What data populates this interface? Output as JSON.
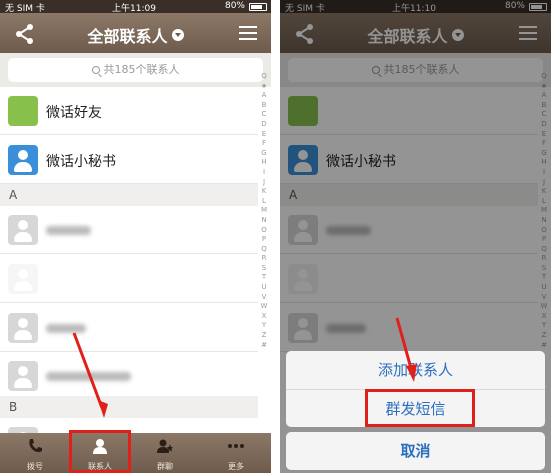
{
  "left": {
    "status": {
      "carrier": "无 SIM 卡",
      "time": "上午11:09",
      "battery": "80%"
    },
    "header": {
      "title": "全部联系人"
    },
    "search": {
      "placeholder": "共185个联系人"
    },
    "rows": [
      {
        "label": "微话好友",
        "avatar": "green"
      },
      {
        "label": "微话小秘书",
        "avatar": "blue"
      }
    ],
    "sections": [
      "A",
      "B"
    ],
    "index": [
      "Q",
      "★",
      "A",
      "B",
      "C",
      "D",
      "E",
      "F",
      "G",
      "H",
      "I",
      "J",
      "K",
      "L",
      "M",
      "N",
      "O",
      "P",
      "Q",
      "R",
      "S",
      "T",
      "U",
      "V",
      "W",
      "X",
      "Y",
      "Z",
      "#"
    ],
    "tabs": [
      {
        "label": "拨号",
        "icon": "phone-icon"
      },
      {
        "label": "联系人",
        "icon": "contacts-icon"
      },
      {
        "label": "群聊",
        "icon": "group-chat-icon"
      },
      {
        "label": "更多",
        "icon": "more-icon"
      }
    ]
  },
  "right": {
    "status": {
      "carrier": "无 SIM 卡",
      "time": "上午11:10",
      "battery": "80%"
    },
    "header": {
      "title": "全部联系人"
    },
    "search": {
      "placeholder": "共185个联系人"
    },
    "rows": [
      {
        "label": "微话小秘书",
        "avatar": "blue"
      }
    ],
    "sections": [
      "A"
    ],
    "sheet": {
      "add_contact": "添加联系人",
      "group_sms": "群发短信",
      "cancel": "取消"
    }
  },
  "colors": {
    "header": "#7d6958",
    "accent": "#2b6fc0",
    "highlight": "#e0201b"
  }
}
